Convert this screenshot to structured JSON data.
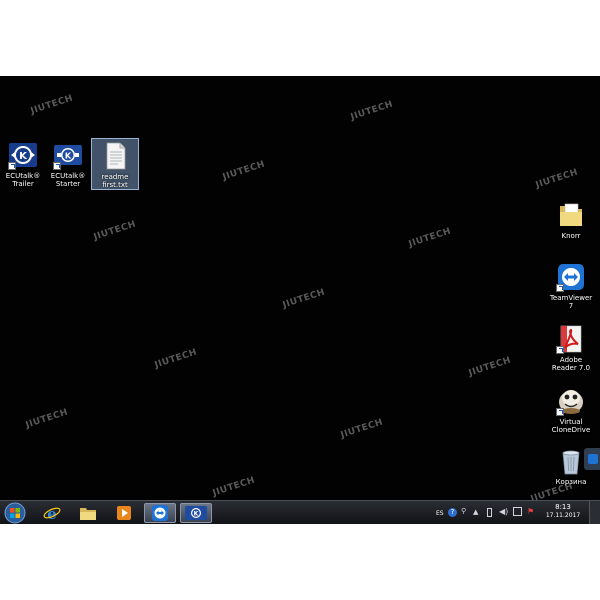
{
  "watermark": "JIUTECH",
  "desktop_left": [
    {
      "label": "ECUtalk® Trailer",
      "icon": "ecutalk-trailer-icon"
    },
    {
      "label": "ECUtalk® Starter",
      "icon": "ecutalk-starter-icon"
    },
    {
      "label": "readme first.txt",
      "icon": "text-file-icon"
    }
  ],
  "desktop_right": [
    {
      "label": "Knorr",
      "icon": "folder-icon"
    },
    {
      "label": "TeamViewer 7",
      "icon": "teamviewer-icon"
    },
    {
      "label": "Adobe Reader 7.0",
      "icon": "adobe-reader-icon"
    },
    {
      "label": "Virtual CloneDrive",
      "icon": "clonedrive-icon"
    },
    {
      "label": "Корзина",
      "icon": "recycle-bin-icon"
    }
  ],
  "taskbar": {
    "pinned": [
      "internet-explorer-icon",
      "explorer-folder-icon",
      "media-player-icon",
      "teamviewer-icon",
      "ecutalk-icon"
    ],
    "language": "ES",
    "time": "8:13",
    "date": "17.11.2017"
  },
  "colors": {
    "desktop": "#020202",
    "taskbar": "#1e2025",
    "selection": "#7896be"
  }
}
